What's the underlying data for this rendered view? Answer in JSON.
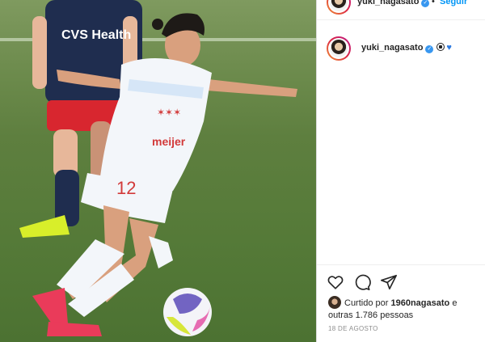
{
  "post": {
    "author": "yuki_nagasato",
    "follow_separator": "•",
    "follow_label": "Seguir",
    "caption_username": "yuki_nagasato",
    "caption_emoji": [
      "soccer-ball",
      "blue-heart"
    ],
    "liked_by_prefix": "Curtido por",
    "liked_by_user": "1960nagasato",
    "liked_by_and": "e",
    "others": "outras 1.786 pessoas",
    "date": "18 DE AGOSTO"
  },
  "photo": {
    "sponsor_text": "CVS Health",
    "jersey_number": "12",
    "sponsor_text_white": "meijer"
  },
  "colors": {
    "accent": "#0095f6",
    "verified": "#3897f0",
    "heart_emoji": "#2f7be0"
  }
}
